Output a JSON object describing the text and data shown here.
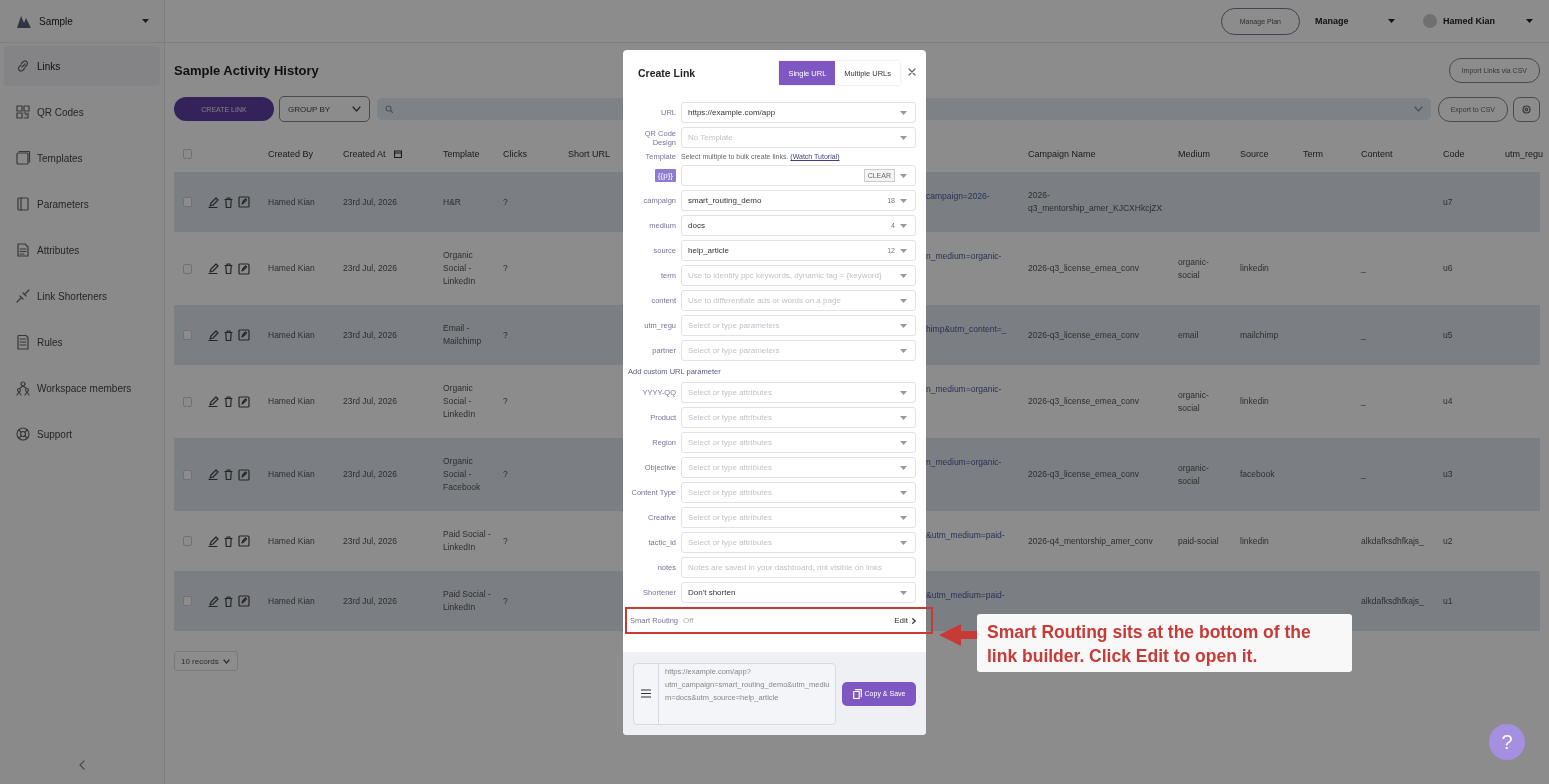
{
  "sidebar": {
    "workspace": "Sample",
    "items": [
      {
        "label": "Links",
        "selected": true
      },
      {
        "label": "QR Codes",
        "selected": false
      },
      {
        "label": "Templates",
        "selected": false
      },
      {
        "label": "Parameters",
        "selected": false
      },
      {
        "label": "Attributes",
        "selected": false
      },
      {
        "label": "Link Shorteners",
        "selected": false
      },
      {
        "label": "Rules",
        "selected": false
      },
      {
        "label": "Workspace members",
        "selected": false
      },
      {
        "label": "Support",
        "selected": false
      }
    ]
  },
  "topbar": {
    "plan_button": "Manage Plan",
    "manage_menu": "Manage",
    "user": "Hamed Kian"
  },
  "page": {
    "title": "Sample Activity History",
    "import_button": "Import Links via CSV",
    "create_button": "CREATE LINK",
    "group_by": "GROUP BY",
    "export_button": "Export to CSV"
  },
  "table": {
    "columns": [
      "Created By",
      "Created At",
      "Template",
      "Clicks",
      "Short URL",
      "Campaign Name",
      "Medium",
      "Source",
      "Term",
      "Content",
      "Code",
      "utm_regu"
    ],
    "rows": [
      {
        "checked": false,
        "created_by": "Hamed Kian",
        "created_at": "23rd Jul, 2026",
        "template": "H&R",
        "clicks": "?",
        "column_8": "campaign=2026-",
        "campaign_name": "2026-q3_mentorship_amer_KJCXHkcjZX",
        "code": "u7"
      },
      {
        "checked": false,
        "created_by": "Hamed Kian",
        "created_at": "23rd Jul, 2026",
        "template": "Organic Social - LinkedIn",
        "clicks": "?",
        "column_8": "n_medium=organic-",
        "campaign_name": "2026-q3_license_emea_conv",
        "medium": "organic-social",
        "source": "linkedin",
        "content": "_",
        "code": "u6"
      },
      {
        "checked": false,
        "created_by": "Hamed Kian",
        "created_at": "23rd Jul, 2026",
        "template": "Email - Mailchimp",
        "clicks": "?",
        "column_8": "himp&utm_content=_",
        "campaign_name": "2026-q3_license_emea_conv",
        "medium": "email",
        "source": "mailchimp",
        "content": "_",
        "code": "u5"
      },
      {
        "checked": false,
        "created_by": "Hamed Kian",
        "created_at": "23rd Jul, 2026",
        "template": "Organic Social - LinkedIn",
        "clicks": "?",
        "column_8": "n_medium=organic-",
        "campaign_name": "2026-q3_license_emea_conv",
        "medium": "organic-social",
        "source": "linkedin",
        "content": "_",
        "code": "u4"
      },
      {
        "checked": false,
        "created_by": "Hamed Kian",
        "created_at": "23rd Jul, 2026",
        "template": "Organic Social - Facebook",
        "clicks": "?",
        "column_8": "n_medium=organic-",
        "campaign_name": "2026-q3_license_emea_conv",
        "medium": "organic-social",
        "source": "facebook",
        "content": "_",
        "code": "u3"
      },
      {
        "checked": false,
        "created_by": "Hamed Kian",
        "created_at": "23rd Jul, 2026",
        "template": "Paid Social - LinkedIn",
        "clicks": "?",
        "column_8": "&utm_medium=paid-",
        "campaign_name": "2026-q4_mentorship_amer_conv",
        "medium": "paid-social",
        "source": "linkedin",
        "content": "alkdafksdhfkajs_",
        "code": "u2"
      },
      {
        "checked": false,
        "created_by": "Hamed Kian",
        "created_at": "23rd Jul, 2026",
        "template": "Paid Social - LinkedIn",
        "clicks": "?",
        "column_8": "&utm_medium=paid-",
        "content": "alkdafksdhfkajs_",
        "code": "u1"
      }
    ],
    "records_select": "10 records",
    "select_all_checked": false
  },
  "help_button": "?",
  "modal": {
    "title": "Create Link",
    "tabs": [
      {
        "label": "Single URL",
        "selected": true
      },
      {
        "label": "Multiple URLs",
        "selected": false
      }
    ],
    "rows": [
      {
        "kind": "select",
        "label": "URL",
        "value": "https://example.com/app"
      },
      {
        "kind": "select",
        "label": "QR Code Design",
        "placeholder": "No Template"
      },
      {
        "kind": "hint",
        "label": "Template",
        "text": "Select multiple to bulk create links.",
        "link": "(Watch Tutorial)"
      },
      {
        "kind": "token",
        "badge": "{{p}}",
        "button": "CLEAR"
      },
      {
        "kind": "select",
        "label": "campaign",
        "value": "smart_routing_demo",
        "count": "18"
      },
      {
        "kind": "select",
        "label": "medium",
        "value": "docs",
        "count": "4"
      },
      {
        "kind": "select",
        "label": "source",
        "value": "help_article",
        "count": "12"
      },
      {
        "kind": "select",
        "label": "term",
        "placeholder": "Use to identify ppc keywords, dynamic tag = {keyword}"
      },
      {
        "kind": "select",
        "label": "content",
        "placeholder": "Use to differentiate ads or words on a page"
      },
      {
        "kind": "select",
        "label": "utm_regu",
        "placeholder": "Select or type parameters"
      },
      {
        "kind": "select",
        "label": "partner",
        "placeholder": "Select or type parameters"
      },
      {
        "kind": "link",
        "text": "Add custom URL parameter"
      },
      {
        "kind": "select",
        "label": "YYYY-QQ",
        "placeholder": "Select or type attributes"
      },
      {
        "kind": "select",
        "label": "Product",
        "placeholder": "Select or type attributes"
      },
      {
        "kind": "select",
        "label": "Region",
        "placeholder": "Select or type attributes"
      },
      {
        "kind": "select",
        "label": "Objective",
        "placeholder": "Select or type attributes"
      },
      {
        "kind": "select",
        "label": "Content Type",
        "placeholder": "Select or type attributes"
      },
      {
        "kind": "select",
        "label": "Creative",
        "placeholder": "Select or type attributes"
      },
      {
        "kind": "select",
        "label": "tactic_id",
        "placeholder": "Select or type attributes"
      },
      {
        "kind": "text",
        "label": "notes",
        "placeholder": "Notes are saved in your dashboard, not visible on links"
      },
      {
        "kind": "select",
        "label": "Shortener",
        "value": "Don't shorten"
      },
      {
        "kind": "routing",
        "label": "Smart Routing",
        "value": "Off",
        "action": "Edit",
        "highlighted": true
      }
    ],
    "preview": "https://example.com/app?utm_campaign=smart_routing_demo&utm_medium=docs&utm_source=help_article",
    "save_button": "Copy & Save"
  },
  "callout": {
    "text": "Smart Routing sits at the bottom of the link builder. Click Edit to open it."
  }
}
